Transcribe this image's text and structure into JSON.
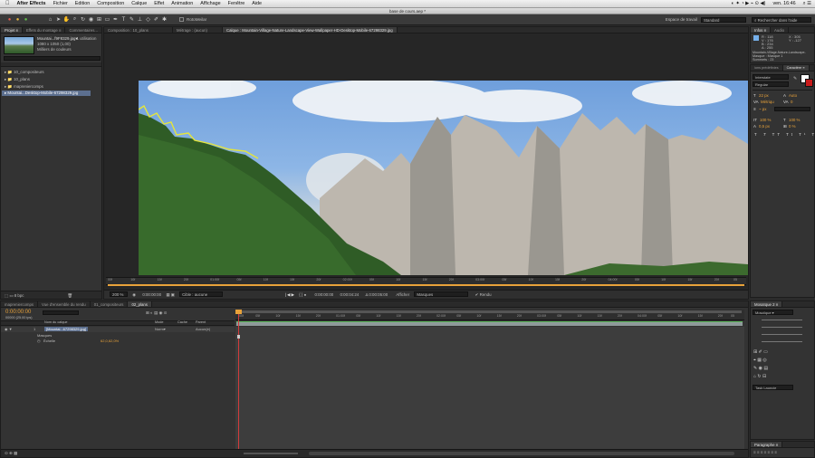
{
  "menubar": {
    "app": "After Effects",
    "items": [
      "Fichier",
      "Edition",
      "Composition",
      "Calque",
      "Effet",
      "Animation",
      "Affichage",
      "Fenêtre",
      "Aide"
    ],
    "clock": "ven. 16:46"
  },
  "document_title": "base de cours.aep *",
  "toolbar": {
    "auto_orient": "RotoMeilar",
    "workspace_label": "Espace de travail",
    "workspace_value": "Standard",
    "search_help": "Rechercher dans l'aide"
  },
  "project": {
    "tabs": [
      "Projet ≡",
      "Effets du montage ≡",
      "Commentaires..."
    ],
    "selected_name": "Mountai...f9F8329.jpg▾",
    "selected_uses": ", 1 utilisation",
    "selected_size": "1080 x 1050 (1,00)",
    "selected_colors": "Milliers de couleurs",
    "items": [
      "▸ 📁 10_compositeurs",
      "▸ 📁 10_plans",
      "▸ 📁 mapreniercomps",
      "▸ Mountai...Desktop-Mobile-67298329.jpg"
    ],
    "bottom_bits": "8 bpc"
  },
  "comp": {
    "tabs": [
      "Composition : 10_plans",
      "Métrage : (aucun)",
      "Calque : Mountain-Village-Nature-Landscape-View-Wallpaper-HD-Desktop-Mobile-67298329.jpg"
    ],
    "ruler_labels": [
      "00f",
      "10f",
      "15f",
      "20f",
      "01:00f",
      "05f",
      "10f",
      "15f",
      "20f",
      "02:00f",
      "05f",
      "10f",
      "15f",
      "20f",
      "03:00f",
      "05f",
      "10f",
      "15f",
      "20f",
      "04:00f",
      "05f",
      "10f",
      "15f",
      "20f",
      "05"
    ],
    "zoom": "200 %",
    "timecode": "0:00:00:00",
    "view_label": "Cible : aucune",
    "time_in": "0:00:00:00",
    "time_dur": "0:00:04:24",
    "time_delta": "Δ 0:00:05:00",
    "show_label": "Afficher",
    "show_value": "Masques",
    "render_label": "Rendu"
  },
  "info": {
    "tabs": [
      "Infos ≡",
      "Audio"
    ],
    "R": "R : 118",
    "G": "V : 176",
    "B": "B : 234",
    "A": "A : 255",
    "X": "X : 305",
    "Y": "Y : -127",
    "name": "Mountain-Village-Nature-Landscape-",
    "mask": "Masque : Masque 1",
    "vertices": "Sommets : 23"
  },
  "chars": {
    "tabs": [
      "ions prédéfinies",
      "Caractère ≡"
    ],
    "font": "Interstate",
    "style": "Regular",
    "size": "22 px",
    "leading": "Auto",
    "tracking": "Métriqu",
    "tracking_val": "0",
    "stroke": "~ px",
    "vscale": "100 %",
    "hscale": "100 %",
    "baseline": "0,5 px",
    "tsume": "0 %",
    "styles": [
      "T",
      "T",
      "TT",
      "Tt",
      "T¹",
      "T₁"
    ]
  },
  "timeline": {
    "tabs": [
      "mapreniercomps",
      "Vue d'ensemble du rendu",
      "01_compositeurs",
      "02_plans"
    ],
    "timecode": "0:00:00:00",
    "fps": "00000 (25.00 ips)",
    "col_name": "Nom du calque",
    "col_mode": "Mode",
    "col_cache": "Cache",
    "col_parent": "Parent",
    "layer_num": "1",
    "layer_name": "[Mountai...67298329.jpg]",
    "layer_mode": "Norm▾",
    "layer_parent": "Aucun(e)",
    "masks": "Masques",
    "scale_label": "Échelle",
    "scale_value": "62,0,62,0%",
    "ruler": [
      "00f",
      "05f",
      "10f",
      "15f",
      "20f",
      "01:00f",
      "05f",
      "10f",
      "15f",
      "20f",
      "02:00f",
      "05f",
      "10f",
      "15f",
      "20f",
      "03:00f",
      "05f",
      "10f",
      "15f",
      "20f",
      "04:00f",
      "05f",
      "10f",
      "15f",
      "20f",
      "05"
    ]
  },
  "tracker": {
    "tabs": [
      "Mosaïque 2 ≡"
    ],
    "dropdown": "Mosaïque ▾",
    "task": "Task Launcie"
  },
  "para": {
    "tab": "Paragraphe ≡"
  }
}
